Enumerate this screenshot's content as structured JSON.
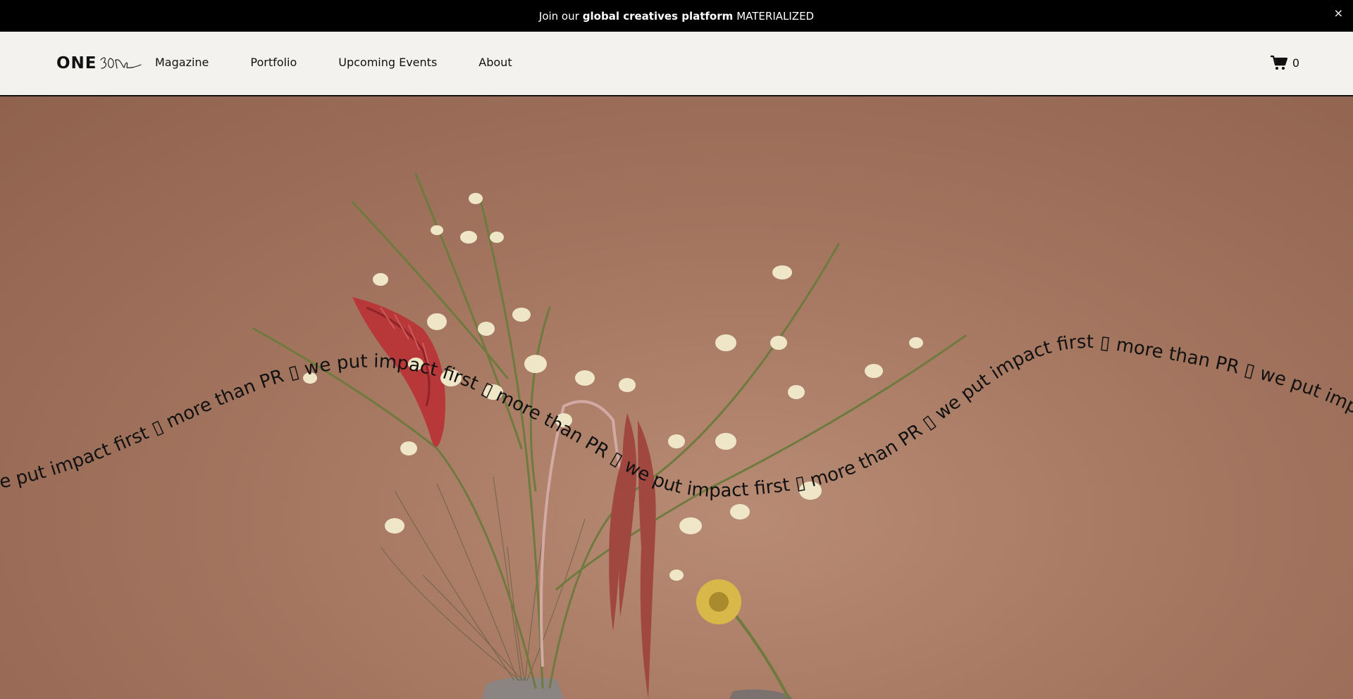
{
  "announcement": {
    "prefix": "Join our",
    "bold": "global creatives platform",
    "suffix": "MATERIALIZED",
    "close_label": "×"
  },
  "header": {
    "logo_word": "ONE",
    "nav": [
      {
        "label": "Magazine"
      },
      {
        "label": "Portfolio"
      },
      {
        "label": "Upcoming Events"
      },
      {
        "label": "About"
      }
    ],
    "cart_count": "0"
  },
  "hero": {
    "marquee": "we put impact first  ▯  more than PR  ▯  we put impact first  ▯  more than PR  ▯  we put impact first  ▯  more than PR  ▯  we put impact first  ▯  more than PR  ▯  we put impact first  ▯  more than PR  ▯  we put impact first  ▯  more than PR",
    "colors": {
      "background": "#a47660",
      "stem": "#6f7a3e",
      "orchid": "#efe6c8",
      "celosia": "#b8383a",
      "amaranth": "#a0483f",
      "daisy": "#d9b84a"
    }
  }
}
